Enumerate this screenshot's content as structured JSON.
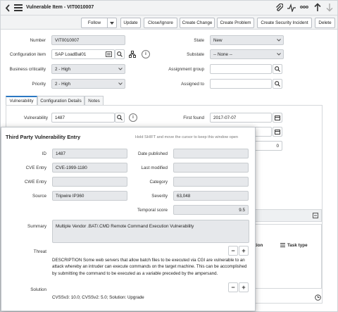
{
  "header": {
    "title": "Vulnerable Item - VIT0010007",
    "buttons": [
      "Follow",
      "Update",
      "Close/Ignore",
      "Create Change",
      "Create Problem",
      "Create Security Incident",
      "Delete"
    ]
  },
  "form": {
    "number_label": "Number",
    "number_value": "VIT0010007",
    "ci_label": "Configuration item",
    "ci_value": "SAP LoadBal01",
    "criticality_label": "Business criticality",
    "criticality_value": "2 - High",
    "priority_label": "Priority",
    "priority_value": "2 - High",
    "state_label": "State",
    "state_value": "New",
    "substate_label": "Substate",
    "substate_value": "-- None --",
    "group_label": "Assignment group",
    "group_value": "",
    "assigned_label": "Assigned to",
    "assigned_value": ""
  },
  "tabs": [
    "Vulnerability",
    "Configuration Details",
    "Notes"
  ],
  "vuln_tab": {
    "vuln_label": "Vulnerability",
    "vuln_value": "1487",
    "first_found_label": "First found",
    "first_found_value": "2017-07-07",
    "count_value": "0"
  },
  "related": {
    "col_fragment": "ition",
    "task_type_label": "Task type"
  },
  "popup": {
    "title": "Third Party Vulnerability Entry",
    "hint": "Hold SHIFT and move the cursor to keep this window open",
    "id_label": "ID",
    "id_value": "1487",
    "cve_label": "CVE Entry",
    "cve_value": "CVE-1999-1180",
    "cwe_label": "CWE Entry",
    "cwe_value": "",
    "source_label": "Source",
    "source_value": "Tripwire IP360",
    "published_label": "Date published",
    "published_value": "",
    "modified_label": "Last modified",
    "modified_value": "",
    "category_label": "Category",
    "category_value": "",
    "severity_label": "Severity",
    "severity_value": "63,048",
    "temporal_label": "Temporal score",
    "temporal_value": "9.5",
    "summary_label": "Summary",
    "summary_value": "Multiple Vendor .BAT/.CMD Remote Command Execution Vulnerability",
    "threat_label": "Threat",
    "threat_text": "DESCRIPTION Some web servers that allow batch files to be executed via CGI are vulnerable to an attack whereby an intruder can execute commands on the target machine. This can be accomplished by submitting the command to be executed as a variable preceded by the ampersand.",
    "solution_label": "Solution",
    "solution_text": "CVSSv3: 10.0; CVSSv2: 5.0; Solution: Upgrade"
  },
  "colors": {
    "accent": "#2b78c2",
    "header_bg": "#f2f3f4",
    "field_bg": "#e6e8eb"
  },
  "icons": [
    "back-icon",
    "menu-icon",
    "paperclip-icon",
    "activity-icon",
    "more-icon",
    "up-arrow-icon",
    "down-arrow-icon"
  ]
}
